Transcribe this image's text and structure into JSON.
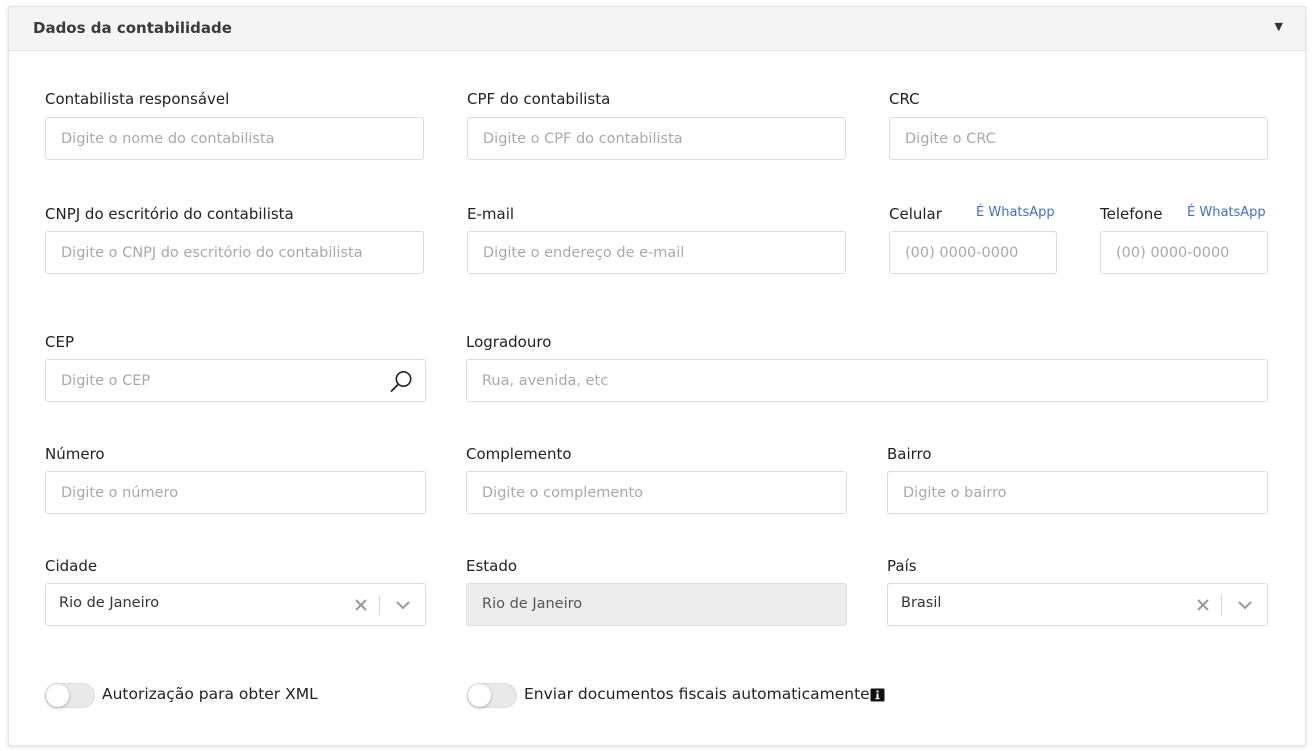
{
  "section": {
    "title": "Dados da contabilidade"
  },
  "fields": {
    "contabilista": {
      "label": "Contabilista responsável",
      "placeholder": "Digite o nome do contabilista"
    },
    "cpf": {
      "label": "CPF do contabilista",
      "placeholder": "Digite o CPF do contabilista"
    },
    "crc": {
      "label": "CRC",
      "placeholder": "Digite o CRC"
    },
    "cnpj": {
      "label": "CNPJ do escritório do contabilista",
      "placeholder": "Digite o CNPJ do escritório do contabilista"
    },
    "email": {
      "label": "E-mail",
      "placeholder": "Digite o endereço de e-mail"
    },
    "celular": {
      "label": "Celular",
      "whatsapp": "É WhatsApp",
      "placeholder": "(00) 0000-0000"
    },
    "telefone": {
      "label": "Telefone",
      "whatsapp": "É WhatsApp",
      "placeholder": "(00) 0000-0000"
    },
    "cep": {
      "label": "CEP",
      "placeholder": "Digite o CEP"
    },
    "logradouro": {
      "label": "Logradouro",
      "placeholder": "Rua, avenida, etc"
    },
    "numero": {
      "label": "Número",
      "placeholder": "Digite o número"
    },
    "complemento": {
      "label": "Complemento",
      "placeholder": "Digite o complemento"
    },
    "bairro": {
      "label": "Bairro",
      "placeholder": "Digite o bairro"
    },
    "cidade": {
      "label": "Cidade",
      "value": "Rio de Janeiro"
    },
    "estado": {
      "label": "Estado",
      "value": "Rio de Janeiro"
    },
    "pais": {
      "label": "País",
      "value": "Brasil"
    }
  },
  "toggles": {
    "xml": {
      "label": "Autorização para obter XML",
      "on": false
    },
    "envio": {
      "label": "Enviar documentos fiscais automaticamente",
      "on": false
    }
  },
  "colors": {
    "link": "#3f6fd1",
    "header_bg": "#f4f4f4",
    "border": "#dcdcdc"
  },
  "icons": [
    "chevron-down-icon",
    "search-icon",
    "clear-icon",
    "info-icon"
  ]
}
